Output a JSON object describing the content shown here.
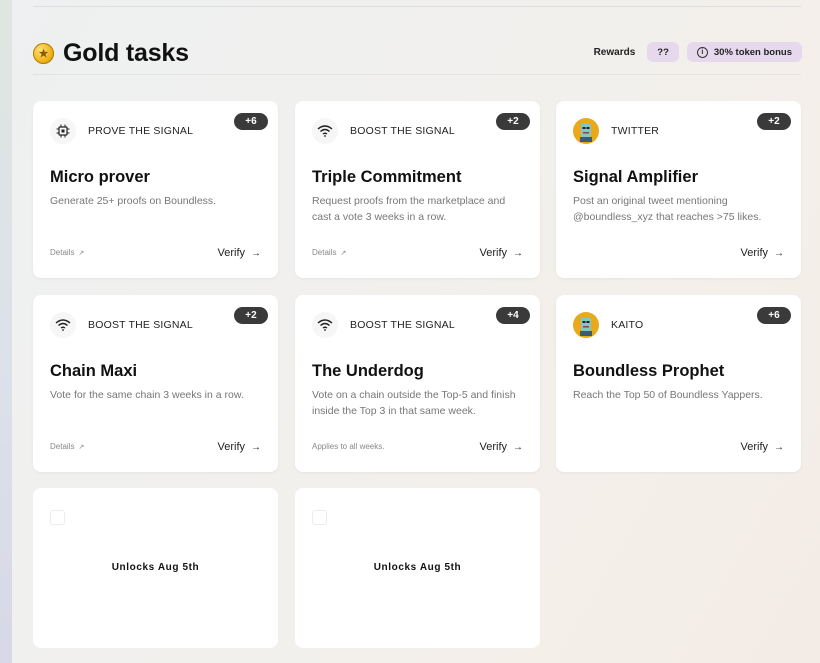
{
  "section": {
    "title": "Gold tasks"
  },
  "rewards": {
    "label": "Rewards",
    "mystery": "??",
    "bonus": "30% token bonus"
  },
  "cards": [
    {
      "category": "PROVE THE SIGNAL",
      "icon": "chip-icon",
      "badge": "+6",
      "name": "Micro prover",
      "desc": "Generate 25+ proofs on Boundless.",
      "footer": "Details",
      "verify": "Verify"
    },
    {
      "category": "BOOST THE SIGNAL",
      "icon": "wifi-icon",
      "badge": "+2",
      "name": "Triple Commitment",
      "desc": "Request proofs from the marketplace and cast a vote 3 weeks in a row.",
      "footer": "Details",
      "verify": "Verify"
    },
    {
      "category": "TWITTER",
      "icon": "avatar-icon",
      "badge": "+2",
      "name": "Signal Amplifier",
      "desc": "Post an original tweet mentioning @boundless_xyz that reaches >75 likes.",
      "footer": "",
      "verify": "Verify"
    },
    {
      "category": "BOOST THE SIGNAL",
      "icon": "wifi-icon",
      "badge": "+2",
      "name": "Chain Maxi",
      "desc": "Vote for the same chain 3 weeks in a row.",
      "footer": "Details",
      "verify": "Verify"
    },
    {
      "category": "BOOST THE SIGNAL",
      "icon": "wifi-icon",
      "badge": "+4",
      "name": "The Underdog",
      "desc": "Vote on a chain outside the Top-5 and finish inside the Top 3 in that same week.",
      "footer": "Applies to all weeks.",
      "verify": "Verify"
    },
    {
      "category": "KAITO",
      "icon": "avatar-icon",
      "badge": "+6",
      "name": "Boundless Prophet",
      "desc": "Reach the Top 50 of Boundless Yappers.",
      "footer": "",
      "verify": "Verify"
    }
  ],
  "locked": [
    {
      "message": "Unlocks Aug 5th"
    },
    {
      "message": "Unlocks Aug 5th"
    }
  ]
}
